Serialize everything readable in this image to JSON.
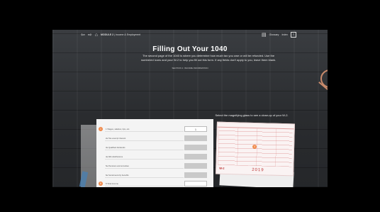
{
  "topbar": {
    "module_label": "MODULE 2",
    "breadcrumb": "Income & Employment",
    "glossary_label": "Glossary",
    "index_label": "Index"
  },
  "main": {
    "title": "Filling Out Your 1040",
    "intro": "The second page of the 1040 is where you determine how much tax you owe or will be refunded. Use the numbered icons and your W-2 to help you fill out this form. If any fields don't apply to you, leave them blank.",
    "section": "SECTION 1: INCOME INFORMATION",
    "select_hint": "Select the magnifying glass to see a close-up of your W-2."
  },
  "form": {
    "rows": [
      {
        "marker": "1",
        "label": "1 Wages, salaries, tips, etc.",
        "value": "1",
        "grey": false
      },
      {
        "marker": "",
        "label": "2a Tax-exempt interest",
        "value": "",
        "grey": true
      },
      {
        "marker": "",
        "label": "3a Qualified dividends",
        "value": "",
        "grey": true
      },
      {
        "marker": "",
        "label": "4a IRA distributions",
        "value": "",
        "grey": true
      },
      {
        "marker": "",
        "label": "5a Pensions and annuities",
        "value": "",
        "grey": true
      },
      {
        "marker": "",
        "label": "6a Social security benefits",
        "value": "",
        "grey": true
      },
      {
        "marker": "6",
        "label": "8 Total income",
        "value": "",
        "grey": false
      }
    ]
  },
  "w2": {
    "marker": "3",
    "tag": "W-2",
    "year": "2019"
  },
  "colors": {
    "marker": "#f08a4b",
    "accent": "#c98a6b"
  },
  "icons": [
    "back-arrow-icon",
    "forward-arrow-icon",
    "home-icon",
    "glossary-icon",
    "index-icon"
  ]
}
